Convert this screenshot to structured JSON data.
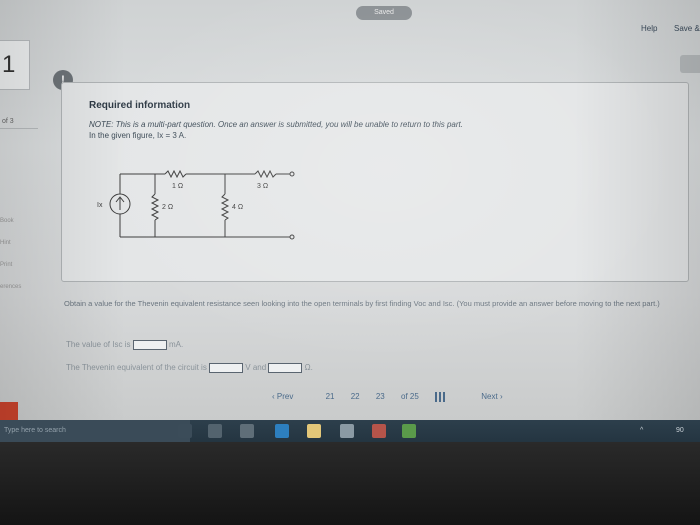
{
  "topbar": {
    "saved": "Saved",
    "help": "Help",
    "save_exit": "Save &"
  },
  "question": {
    "number": "1",
    "of": "of 3"
  },
  "sidebar": {
    "links": [
      "Book",
      "Hint",
      "Print",
      "erences"
    ]
  },
  "card": {
    "alert": "!",
    "title": "Required information",
    "note": "NOTE: This is a multi-part question. Once an answer is submitted, you will be unable to return to this part.",
    "given": "In the given figure, Ix = 3 A."
  },
  "circuit": {
    "source": "Ix",
    "r1": "1 Ω",
    "r2": "2 Ω",
    "r3": "3 Ω",
    "r4": "4 Ω"
  },
  "prompt": {
    "text": "Obtain a value for the Thevenin equivalent resistance seen looking into the open terminals by first finding Voc and Isc. (You must provide an answer before moving to the next part.)",
    "line1_prefix": "The value of Isc is",
    "line1_unit": "mA.",
    "line2_prefix": "The Thevenin equivalent of the circuit is",
    "line2_mid": "V and",
    "line2_unit": "Ω."
  },
  "pager": {
    "prev": "‹  Prev",
    "p21": "21",
    "p22": "22",
    "p23": "23",
    "of": "of 25",
    "next": "Next  ›"
  },
  "taskbar": {
    "search": "Type here to search",
    "time": "90"
  },
  "colors": {
    "taskbar": "#2d3f4c",
    "accent": "#4a6a8a",
    "badge": "#c9432c"
  }
}
